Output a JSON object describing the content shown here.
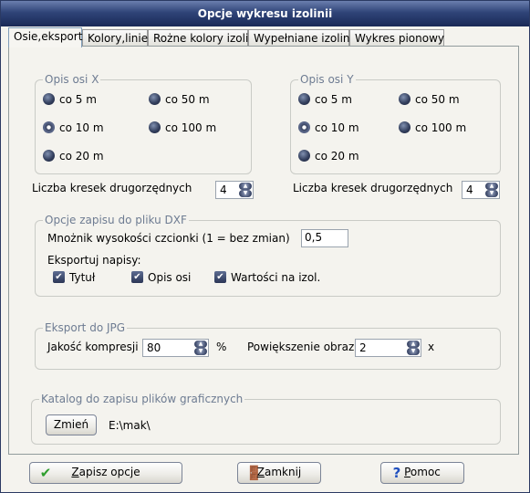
{
  "window": {
    "title": "Opcje wykresu izolinii"
  },
  "tabs": [
    {
      "label": "Osie,eksport",
      "active": true
    },
    {
      "label": "Kolory,linie",
      "active": false
    },
    {
      "label": "Rożne kolory izolinii",
      "active": false
    },
    {
      "label": "Wypełniane izolinie",
      "active": false
    },
    {
      "label": "Wykres pionowy",
      "active": false
    }
  ],
  "axis_x": {
    "title": "Opis osi X",
    "options": [
      "co 5 m",
      "co 50 m",
      "co 10 m",
      "co 100 m",
      "co 20 m"
    ],
    "selected": "co 10 m",
    "minor_ticks_label": "Liczba kresek drugorzędnych",
    "minor_ticks_value": "4"
  },
  "axis_y": {
    "title": "Opis osi Y",
    "options": [
      "co 5 m",
      "co 50 m",
      "co 10 m",
      "co 100 m",
      "co 20 m"
    ],
    "selected": "co 10 m",
    "minor_ticks_label": "Liczba kresek drugorzędnych",
    "minor_ticks_value": "4"
  },
  "dxf": {
    "title": "Opcje zapisu do pliku DXF",
    "font_mult_label": "Mnożnik wysokości czcionki (1 = bez zmian)",
    "font_mult_value": "0,5",
    "export_labels": "Eksportuj napisy:",
    "checks": [
      {
        "label": "Tytuł",
        "checked": true
      },
      {
        "label": "Opis osi",
        "checked": true
      },
      {
        "label": "Wartości na izol.",
        "checked": true
      }
    ]
  },
  "jpg": {
    "title": "Eksport do JPG",
    "quality_label": "Jakość kompresji",
    "quality_value": "80",
    "quality_unit": "%",
    "zoom_label": "Powiększenie obrazu",
    "zoom_value": "2",
    "zoom_unit": "x"
  },
  "catalog": {
    "title": "Katalog do zapisu plików graficznych",
    "change_button": "Zmień",
    "path": "E:\\mak\\"
  },
  "buttons": {
    "save": {
      "mnemonic": "Z",
      "rest": "apisz opcje"
    },
    "close": {
      "mnemonic": "Z",
      "rest": "amknij"
    },
    "help": {
      "mnemonic": "P",
      "rest": "omoc"
    }
  }
}
